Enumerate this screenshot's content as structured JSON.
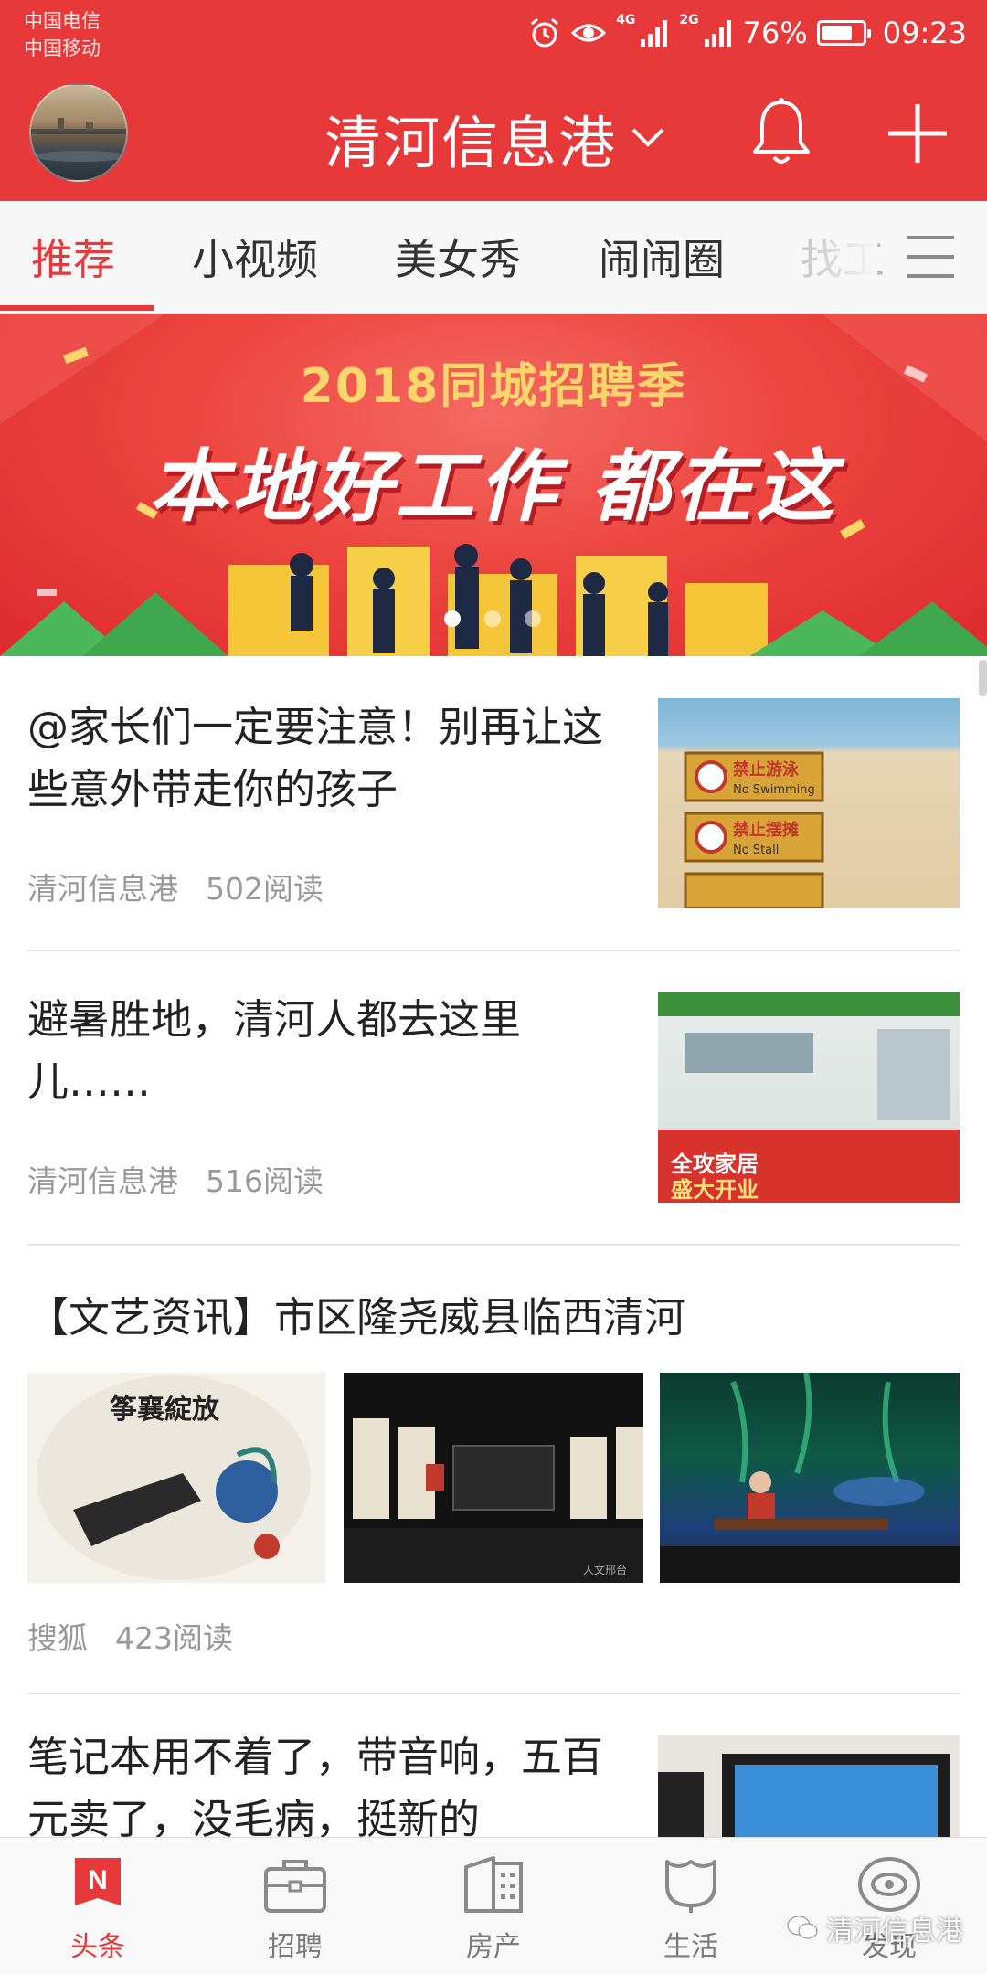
{
  "status_bar": {
    "carrier_1": "中国电信",
    "carrier_2": "中国移动",
    "network_1": "4G",
    "network_2": "2G",
    "battery_text": "76%",
    "battery_level": 0.76,
    "time": "09:23",
    "icons": [
      "alarm-icon",
      "eye-icon",
      "signal-icon",
      "battery-icon"
    ]
  },
  "header": {
    "title": "清河信息港",
    "icons": [
      "avatar",
      "chevron-down-icon",
      "bell-icon",
      "plus-icon"
    ]
  },
  "tabs": {
    "items": [
      {
        "label": "推荐",
        "active": true
      },
      {
        "label": "小视频"
      },
      {
        "label": "美女秀"
      },
      {
        "label": "闹闹圈"
      },
      {
        "label": "找工"
      }
    ],
    "menu_icon": "menu-icon"
  },
  "banner": {
    "subtitle": "2018同城招聘季",
    "title": "本地好工作 都在这",
    "dots_count": 3,
    "active_dot": 0
  },
  "feed": [
    {
      "type": "single-image",
      "title": "@家长们一定要注意！别再让这些意外带走你的孩子",
      "source": "清河信息港",
      "reads": "502阅读",
      "image_text": [
        "禁止游泳",
        "No Swimming",
        "禁止摆摊",
        "No Stall"
      ]
    },
    {
      "type": "single-image",
      "title": "避暑胜地，清河人都去这里儿……",
      "source": "清河信息港",
      "reads": "516阅读",
      "image_text": [
        "全攻家居",
        "盛大开业"
      ]
    },
    {
      "type": "three-images",
      "title": "【文艺资讯】市区隆尧威县临西清河",
      "source": "搜狐",
      "reads": "423阅读",
      "image_text": [
        "筝襄綻放",
        "人文邢台"
      ]
    },
    {
      "type": "single-image",
      "title": "笔记本用不着了，带音响，五百元卖了，没毛病，挺新的"
    }
  ],
  "bottom_nav": {
    "items": [
      {
        "label": "头条",
        "icon": "news-icon",
        "active": true
      },
      {
        "label": "招聘",
        "icon": "briefcase-icon"
      },
      {
        "label": "房产",
        "icon": "building-icon"
      },
      {
        "label": "生活",
        "icon": "tulip-icon"
      },
      {
        "label": "发现",
        "icon": "discover-eye-icon"
      }
    ]
  },
  "watermark": {
    "text": "清河信息港",
    "icon": "wechat-icon"
  },
  "colors": {
    "brand_red": "#e8393a",
    "tab_active": "#e8393a",
    "meta_gray": "#999999"
  }
}
